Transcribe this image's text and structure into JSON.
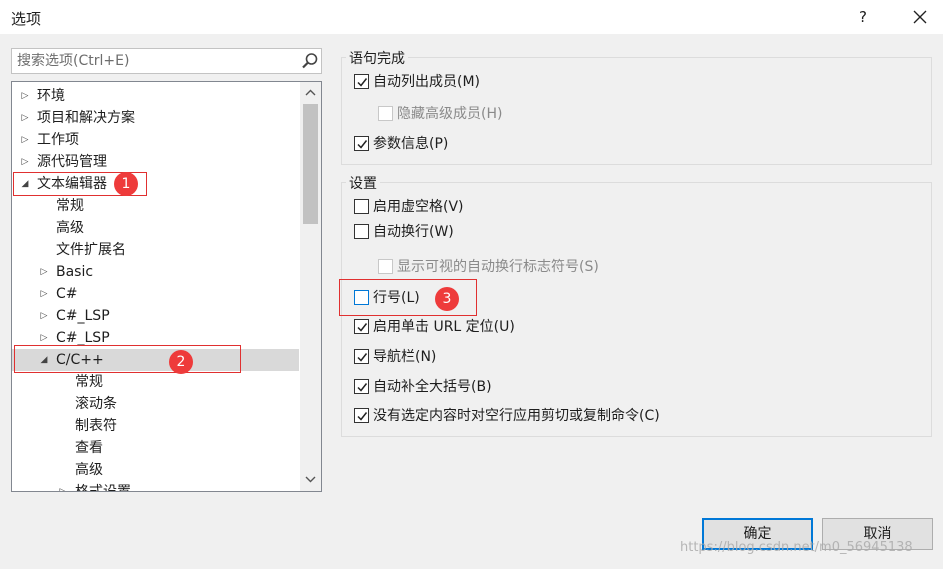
{
  "window": {
    "title": "选项",
    "help_label": "?"
  },
  "search": {
    "placeholder": "搜索选项(Ctrl+E)"
  },
  "tree": {
    "items": [
      {
        "label": "环境",
        "arrow": "▷"
      },
      {
        "label": "项目和解决方案",
        "arrow": "▷"
      },
      {
        "label": "工作项",
        "arrow": "▷"
      },
      {
        "label": "源代码管理",
        "arrow": "▷"
      },
      {
        "label": "文本编辑器",
        "arrow": "◢"
      },
      {
        "label": "常规",
        "arrow": ""
      },
      {
        "label": "高级",
        "arrow": ""
      },
      {
        "label": "文件扩展名",
        "arrow": ""
      },
      {
        "label": "Basic",
        "arrow": "▷"
      },
      {
        "label": "C#",
        "arrow": "▷"
      },
      {
        "label": "C#_LSP",
        "arrow": "▷"
      },
      {
        "label": "C#_LSP",
        "arrow": "▷"
      },
      {
        "label": "C/C++",
        "arrow": "◢"
      },
      {
        "label": "常规",
        "arrow": ""
      },
      {
        "label": "滚动条",
        "arrow": ""
      },
      {
        "label": "制表符",
        "arrow": ""
      },
      {
        "label": "查看",
        "arrow": ""
      },
      {
        "label": "高级",
        "arrow": ""
      },
      {
        "label": "格式设置",
        "arrow": "▷"
      }
    ]
  },
  "statement_completion": {
    "title": "语句完成",
    "options": [
      {
        "label": "自动列出成员(M)",
        "checked": true
      },
      {
        "label": "隐藏高级成员(H)",
        "checked": false,
        "disabled": true
      },
      {
        "label": "参数信息(P)",
        "checked": true
      }
    ]
  },
  "settings": {
    "title": "设置",
    "options": [
      {
        "label": "启用虚空格(V)",
        "checked": false
      },
      {
        "label": "自动换行(W)",
        "checked": false
      },
      {
        "label": "显示可视的自动换行标志符号(S)",
        "checked": false,
        "disabled": true
      },
      {
        "label": "行号(L)",
        "checked": false
      },
      {
        "label": "启用单击 URL 定位(U)",
        "checked": true
      },
      {
        "label": "导航栏(N)",
        "checked": true
      },
      {
        "label": "自动补全大括号(B)",
        "checked": true
      },
      {
        "label": "没有选定内容时对空行应用剪切或复制命令(C)",
        "checked": true
      }
    ]
  },
  "annotations": {
    "badge1": "1",
    "badge2": "2",
    "badge3": "3"
  },
  "buttons": {
    "ok": "确定",
    "cancel": "取消"
  },
  "watermark": "https://blog.csdn.net/m0_56945138",
  "colors": {
    "accent": "#0078d7",
    "annotation_red": "#e03030",
    "badge_red": "#ee3b3b",
    "selected_row": "#d9d9d9"
  }
}
